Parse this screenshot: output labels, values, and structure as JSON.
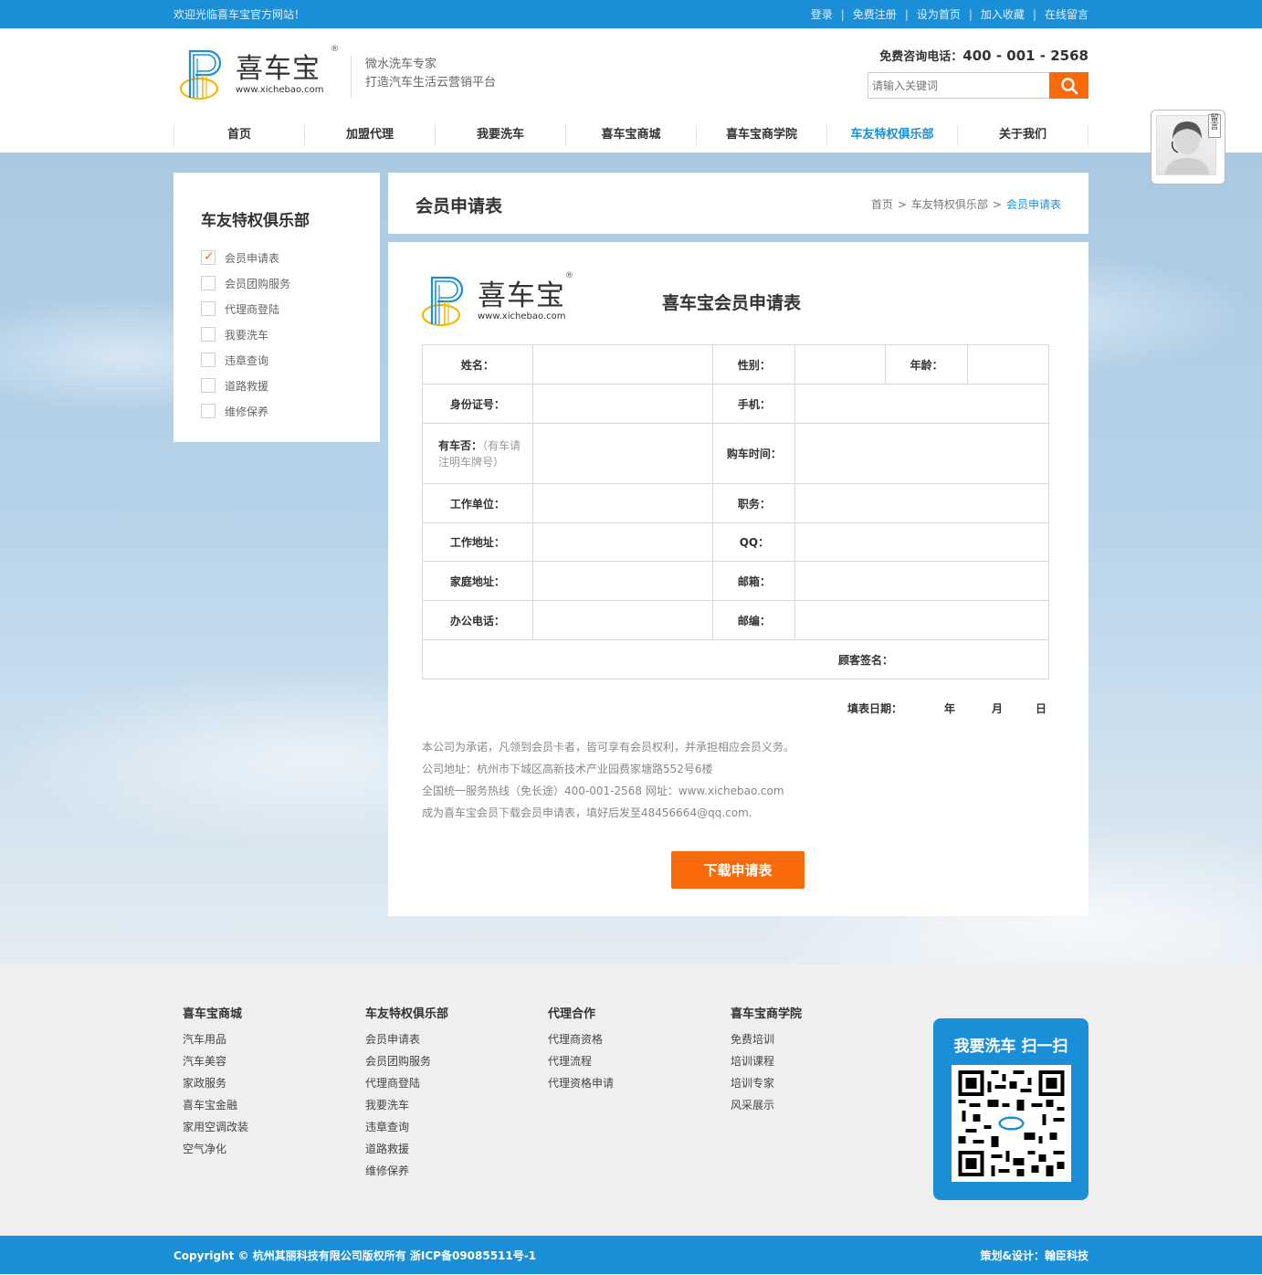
{
  "topbar": {
    "welcome": "欢迎光临喜车宝官方网站！",
    "links": [
      "登录",
      "免费注册",
      "设为首页",
      "加入收藏",
      "在线留言"
    ]
  },
  "header": {
    "logo_cn": "喜车宝",
    "logo_url": "www.xichebao.com",
    "logo_reg": "®",
    "slogan_line1": "微水洗车专家",
    "slogan_line2": "打造汽车生活云营销平台",
    "hotline_label": "免费咨询电话：",
    "hotline_number": "400 - 001 - 2568",
    "search_placeholder": "请输入关键词"
  },
  "nav": {
    "items": [
      "首页",
      "加盟代理",
      "我要洗车",
      "喜车宝商城",
      "喜车宝商学院",
      "车友特权俱乐部",
      "关于我们"
    ],
    "active_index": 5
  },
  "sidebar": {
    "title": "车友特权俱乐部",
    "items": [
      "会员申请表",
      "会员团购服务",
      "代理商登陆",
      "我要洗车",
      "违章查询",
      "道路救援",
      "维修保养"
    ],
    "checked_index": 0
  },
  "titlebar": {
    "title": "会员申请表",
    "breadcrumb": [
      "首页",
      "车友特权俱乐部",
      "会员申请表"
    ],
    "separator": ">"
  },
  "form": {
    "title": "喜车宝会员申请表",
    "labels": {
      "name": "姓名：",
      "gender": "性别：",
      "age": "年龄：",
      "id_no": "身份证号：",
      "mobile": "手机：",
      "has_car": "有车否：",
      "has_car_note": "（有车请注明车牌号）",
      "buy_time": "购车时间：",
      "work_unit": "工作单位：",
      "position": "职务：",
      "work_addr": "工作地址：",
      "qq": "QQ：",
      "home_addr": "家庭地址：",
      "email": "邮箱：",
      "office_tel": "办公电话：",
      "postcode": "邮编：",
      "signature": "顾客签名："
    },
    "date": {
      "label": "填表日期：",
      "year": "年",
      "month": "月",
      "day": "日"
    },
    "info": [
      "本公司为承诺，凡领到会员卡者，皆可享有会员权利，并承担相应会员义务。",
      "公司地址：杭州市下城区高新技术产业园费家塘路552号6楼",
      "全国统一服务热线（免长途）400-001-2568 网址：www.xichebao.com",
      "成为喜车宝会员下载会员申请表，填好后发至48456664@qq.com."
    ],
    "download_label": "下载申请表"
  },
  "service": {
    "tag": "留言"
  },
  "footer": {
    "columns": [
      {
        "title": "喜车宝商城",
        "links": [
          "汽车用品",
          "汽车美容",
          "家政服务",
          "喜车宝金融",
          "家用空调改装",
          "空气净化"
        ]
      },
      {
        "title": "车友特权俱乐部",
        "links": [
          "会员申请表",
          "会员团购服务",
          "代理商登陆",
          "我要洗车",
          "违章查询",
          "道路救援",
          "维修保养"
        ]
      },
      {
        "title": "代理合作",
        "links": [
          "代理商资格",
          "代理流程",
          "代理资格申请"
        ]
      },
      {
        "title": "喜车宝商学院",
        "links": [
          "免费培训",
          "培训课程",
          "培训专家",
          "风采展示"
        ]
      }
    ],
    "qr_title": "我要洗车 扫一扫"
  },
  "bottom": {
    "copyright": "Copyright © 杭州其丽科技有限公司版权所有 浙ICP备09085511号-1",
    "design": "策划&设计：翰臣科技"
  },
  "colors": {
    "primary": "#1a8fd8",
    "accent": "#fb6a0a"
  }
}
